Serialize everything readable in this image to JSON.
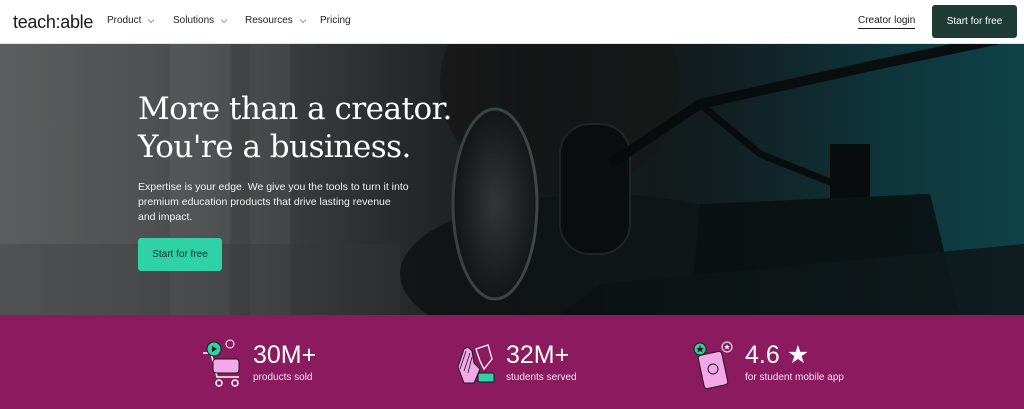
{
  "nav": {
    "logo": "teach:able",
    "menu": [
      {
        "label": "Product",
        "has_dropdown": true
      },
      {
        "label": "Solutions",
        "has_dropdown": true
      },
      {
        "label": "Resources",
        "has_dropdown": true
      },
      {
        "label": "Pricing",
        "has_dropdown": false
      }
    ],
    "login_label": "Creator login",
    "cta_label": "Start for free"
  },
  "hero": {
    "title_line1": "More than a creator.",
    "title_line2": "You're a business.",
    "subtitle": "Expertise is your edge. We give you the tools to turn it into premium education products that drive lasting revenue and impact.",
    "cta_label": "Start for free"
  },
  "stats": [
    {
      "value": "30M+",
      "label": "products sold",
      "icon": "shopping-cart-icon"
    },
    {
      "value": "32M+",
      "label": "students served",
      "icon": "high-five-hands-icon"
    },
    {
      "value": "4.6 ★",
      "label": "for student mobile app",
      "icon": "mobile-app-icon"
    }
  ],
  "colors": {
    "nav_cta_bg": "#1e3b34",
    "hero_cta_bg": "#2fd2a5",
    "stats_bg": "#8c1a5e",
    "icon_accent_pink": "#f4a8e8",
    "icon_accent_green": "#2fd2a5"
  }
}
